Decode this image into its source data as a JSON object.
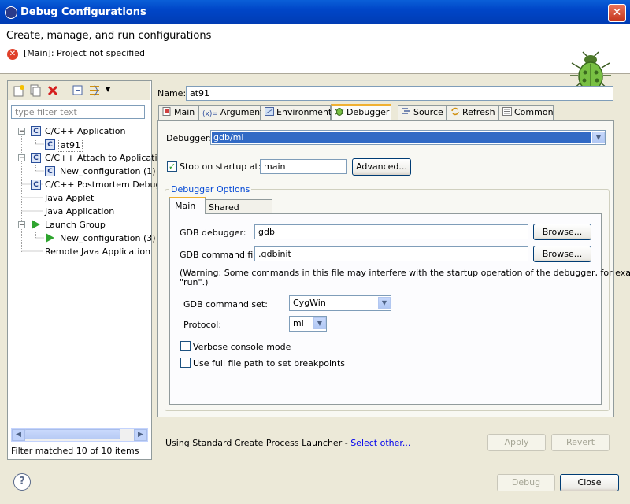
{
  "window": {
    "title": "Debug Configurations",
    "close_glyph": "✕"
  },
  "header": {
    "title": "Create, manage, and run configurations",
    "error": "[Main]: Project not specified"
  },
  "left": {
    "filter_placeholder": "type filter text",
    "tree": [
      {
        "label": "C/C++ Application",
        "expanded": true
      },
      {
        "label": "at91"
      },
      {
        "label": "C/C++ Attach to Applicatic",
        "expanded": true
      },
      {
        "label": "New_configuration (1)"
      },
      {
        "label": "C/C++ Postmortem Debug"
      },
      {
        "label": "Java Applet"
      },
      {
        "label": "Java Application"
      },
      {
        "label": "Launch Group",
        "expanded": true
      },
      {
        "label": "New_configuration (3)"
      },
      {
        "label": "Remote Java Application"
      }
    ],
    "filter_status": "Filter matched 10 of 10 items"
  },
  "name": {
    "label": "Name:",
    "value": "at91"
  },
  "tabs": [
    {
      "label": "Main",
      "icon": "main-tab-icon"
    },
    {
      "label": "Arguments",
      "icon": "arguments-icon"
    },
    {
      "label": "Environment",
      "icon": "environment-icon"
    },
    {
      "label": "Debugger",
      "icon": "debugger-icon",
      "active": true
    },
    {
      "label": "Source",
      "icon": "source-icon"
    },
    {
      "label": "Refresh",
      "icon": "refresh-icon"
    },
    {
      "label": "Common",
      "icon": "common-icon"
    }
  ],
  "debugger": {
    "label": "Debugger:",
    "value": "gdb/mi",
    "stop_on_startup_label": "Stop on startup at:",
    "stop_on_startup_checked": true,
    "stop_on_startup_value": "main",
    "advanced_button": "Advanced..."
  },
  "options": {
    "group_label": "Debugger Options",
    "tabs": [
      {
        "label": "Main",
        "active": true
      },
      {
        "label": "Shared Libraries"
      }
    ],
    "gdb_debugger_label": "GDB debugger:",
    "gdb_debugger_value": "gdb",
    "browse1": "Browse...",
    "gdb_command_file_label": "GDB command file:",
    "gdb_command_file_value": ".gdbinit",
    "browse2": "Browse...",
    "warning_line1": "(Warning: Some commands in this file may interfere with the startup operation of the debugger, for example",
    "warning_line2": "\"run\".)",
    "command_set_label": "GDB command set:",
    "command_set_value": "CygWin",
    "protocol_label": "Protocol:",
    "protocol_value": "mi",
    "verbose_label": "Verbose console mode",
    "verbose_checked": false,
    "fullpath_label": "Use full file path to set breakpoints",
    "fullpath_checked": false
  },
  "launcher": {
    "text": "Using Standard Create Process Launcher - ",
    "link": "Select other..."
  },
  "buttons": {
    "apply": "Apply",
    "revert": "Revert",
    "debug": "Debug",
    "close": "Close",
    "help": "?"
  }
}
